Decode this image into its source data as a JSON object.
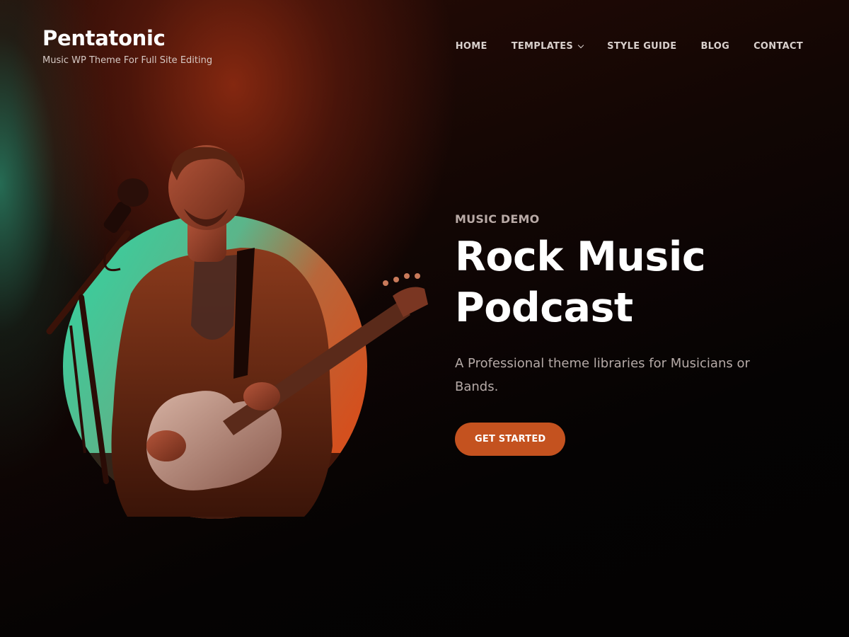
{
  "header": {
    "site_title": "Pentatonic",
    "tagline": "Music WP Theme For Full Site Editing"
  },
  "nav": {
    "items": [
      {
        "label": "HOME"
      },
      {
        "label": "TEMPLATES",
        "has_dropdown": true
      },
      {
        "label": "STYLE GUIDE"
      },
      {
        "label": "BLOG"
      },
      {
        "label": "CONTACT"
      }
    ]
  },
  "hero": {
    "eyebrow": "MUSIC DEMO",
    "title_line1": "Rock Music",
    "title_line2": "Podcast",
    "description": "A Professional theme libraries for Musicians or Bands.",
    "cta_label": "GET STARTED",
    "image_subject": "guitarist-at-microphone"
  },
  "colors": {
    "accent": "#c4521f",
    "circle_gradient_start": "#2fd6a3",
    "circle_gradient_end": "#d4501e",
    "background": "#050303"
  }
}
